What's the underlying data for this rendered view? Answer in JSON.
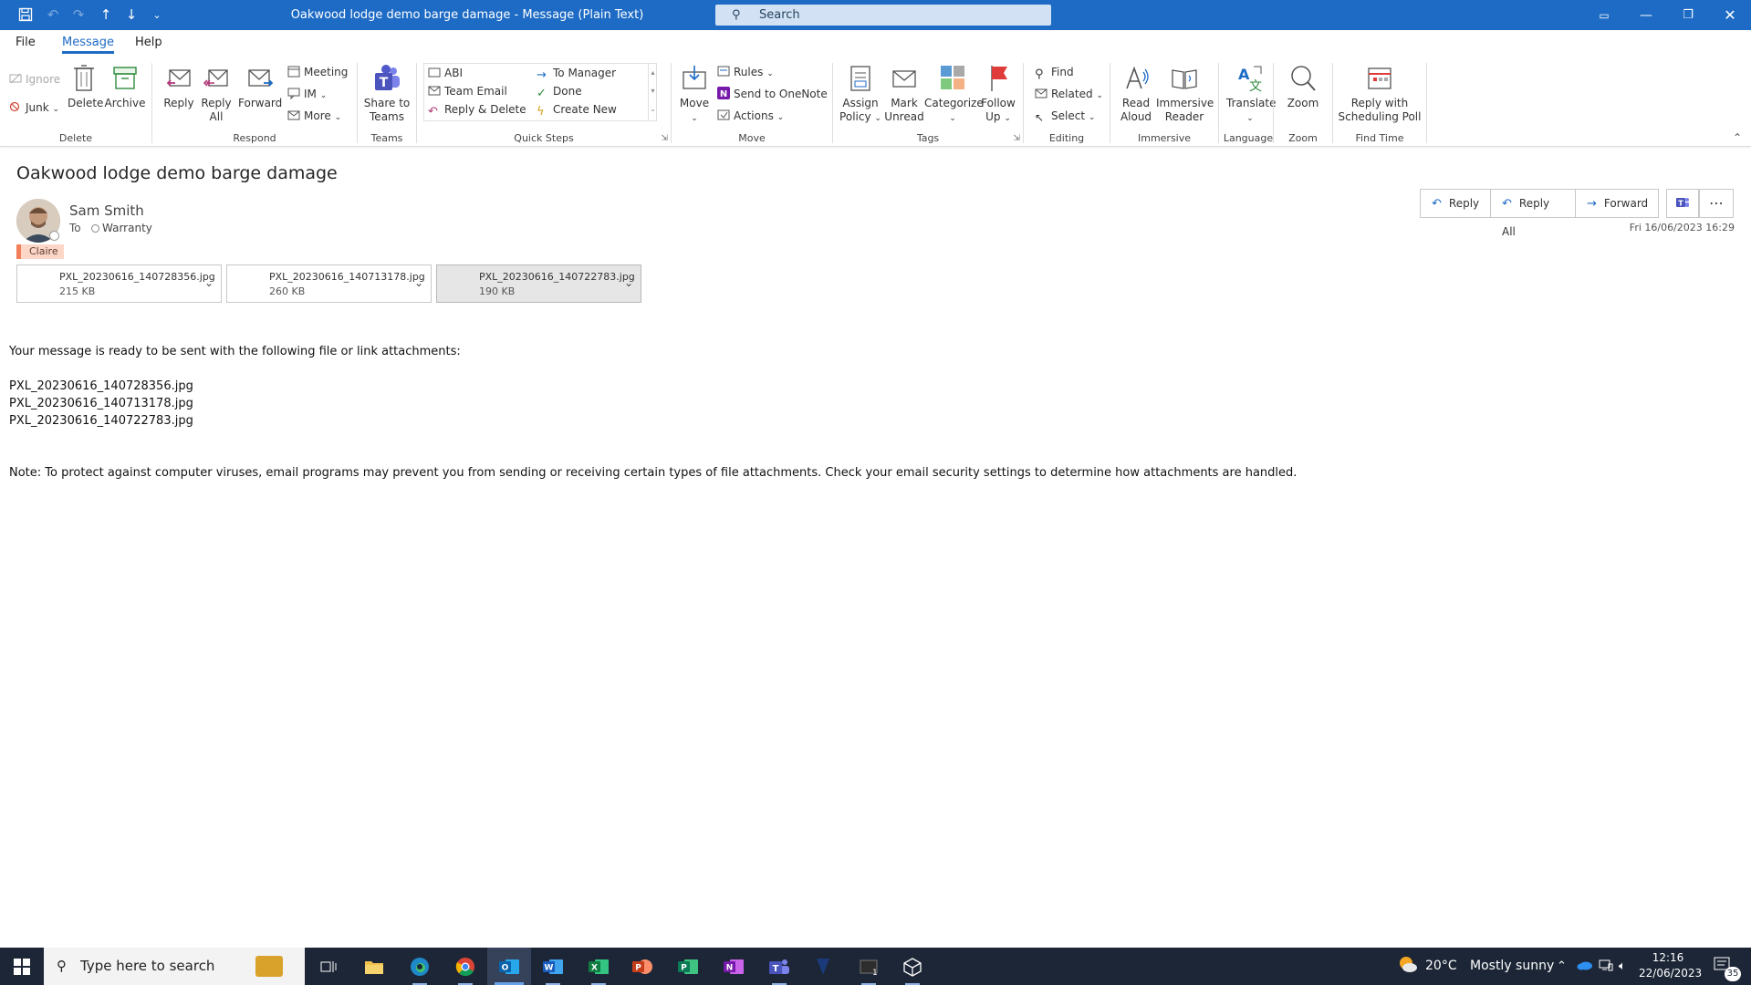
{
  "window": {
    "title": "Oakwood lodge demo barge damage  -  Message (Plain Text)",
    "search_placeholder": "Search"
  },
  "menu_tabs": [
    {
      "label": "File",
      "active": false
    },
    {
      "label": "Message",
      "active": true
    },
    {
      "label": "Help",
      "active": false
    }
  ],
  "ribbon": {
    "delete_group": {
      "name": "Delete",
      "ignore": "Ignore",
      "junk": "Junk",
      "delete": "Delete",
      "archive": "Archive"
    },
    "respond_group": {
      "name": "Respond",
      "reply": "Reply",
      "reply_all_1": "Reply",
      "reply_all_2": "All",
      "forward": "Forward",
      "meeting": "Meeting",
      "im": "IM",
      "more": "More"
    },
    "teams_group": {
      "name": "Teams",
      "share_1": "Share to",
      "share_2": "Teams"
    },
    "quicksteps_group": {
      "name": "Quick Steps",
      "items": [
        "ABI",
        "Team Email",
        "Reply & Delete",
        "To Manager",
        "Done",
        "Create New"
      ]
    },
    "move_group": {
      "name": "Move",
      "move": "Move",
      "rules": "Rules",
      "onenote": "Send to OneNote",
      "actions": "Actions"
    },
    "tags_group": {
      "name": "Tags",
      "assign_1": "Assign",
      "assign_2": "Policy",
      "mark_1": "Mark",
      "mark_2": "Unread",
      "categorize": "Categorize",
      "follow_1": "Follow",
      "follow_2": "Up"
    },
    "editing_group": {
      "name": "Editing",
      "find": "Find",
      "related": "Related",
      "select": "Select"
    },
    "immersive_group": {
      "name": "Immersive",
      "read_1": "Read",
      "read_2": "Aloud",
      "reader_1": "Immersive",
      "reader_2": "Reader"
    },
    "language_group": {
      "name": "Language",
      "translate": "Translate"
    },
    "zoom_group": {
      "name": "Zoom",
      "zoom": "Zoom"
    },
    "findtime_group": {
      "name": "Find Time",
      "poll_1": "Reply with",
      "poll_2": "Scheduling Poll"
    }
  },
  "message": {
    "subject": "Oakwood lodge demo barge damage",
    "sender": "Sam Smith",
    "to_label": "To",
    "recipient": "Warranty",
    "category": "Claire",
    "datetime": "Fri 16/06/2023 16:29",
    "actions": {
      "reply": "Reply",
      "reply_all": "Reply All",
      "forward": "Forward"
    },
    "attachments": [
      {
        "name": "PXL_20230616_140728356.jpg",
        "size": "215 KB"
      },
      {
        "name": "PXL_20230616_140713178.jpg",
        "size": "260 KB"
      },
      {
        "name": "PXL_20230616_140722783.jpg",
        "size": "190 KB"
      }
    ],
    "body": {
      "intro": "Your message is ready to be sent with the following file or link attachments:",
      "files": [
        "PXL_20230616_140728356.jpg",
        "PXL_20230616_140713178.jpg",
        "PXL_20230616_140722783.jpg"
      ],
      "note": "Note: To protect against computer viruses, email programs may prevent you from sending or receiving certain types of file attachments. Check your email security settings to determine how attachments are handled."
    }
  },
  "taskbar": {
    "search_placeholder": "Type here to search",
    "weather_temp": "20°C",
    "weather_desc": "Mostly sunny",
    "time": "12:16",
    "date": "22/06/2023",
    "notification_count": "35"
  },
  "colors": {
    "accent": "#1d6bc5",
    "category": "#f07f5a",
    "taskbar": "#1c2636"
  }
}
